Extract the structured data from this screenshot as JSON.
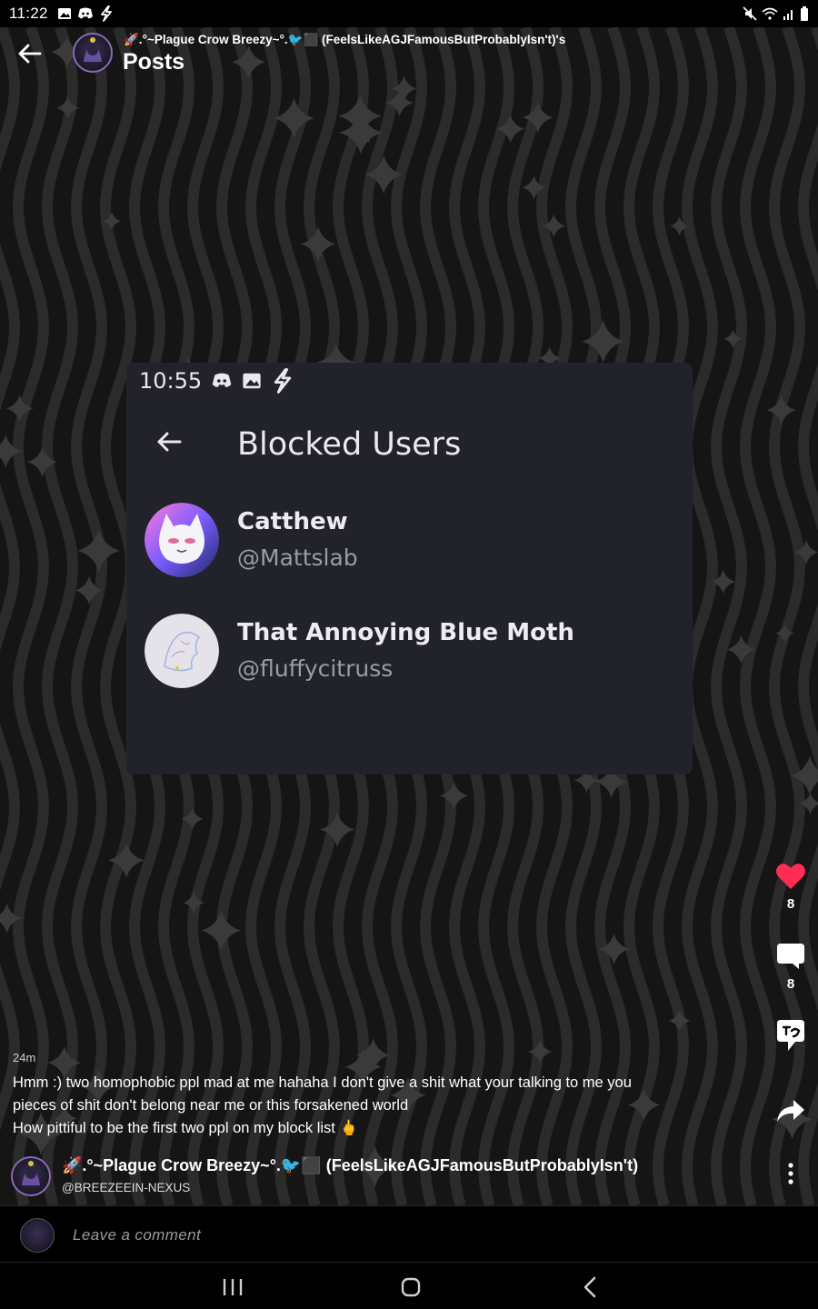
{
  "status_bar": {
    "time": "11:22",
    "left_icons": [
      "gallery-icon",
      "discord-icon",
      "bolt-icon"
    ],
    "right_icons": [
      "mute-icon",
      "wifi-icon",
      "signal-icon",
      "battery-icon"
    ]
  },
  "header": {
    "subtitle": "🚀.°~Plague Crow Breezy~°.🐦⬛ (FeelsLikeAGJFamousButProbablyIsn't)'s",
    "title": "Posts"
  },
  "post_image": {
    "status_time": "10:55",
    "status_icons": [
      "discord-icon",
      "gallery-icon",
      "bolt-icon"
    ],
    "title": "Blocked Users",
    "users": [
      {
        "name": "Catthew",
        "handle": "@Mattslab"
      },
      {
        "name": "That Annoying Blue Moth",
        "handle": "@fluffycitruss"
      }
    ]
  },
  "actions": {
    "like_count": "8",
    "comment_count": "8",
    "colors": {
      "like": "#ff2d55"
    }
  },
  "caption": {
    "timestamp": "24m",
    "text": "Hmm :) two homophobic ppl mad at me hahaha I don't give a shit what your talking to me you\npieces of shit don't belong near me or this forsakened world\nHow pittiful to be the first two ppl on my block list 🖕"
  },
  "author": {
    "name": "🚀.°~Plague Crow Breezy~°.🐦⬛ (FeelsLikeAGJFamousButProbablyIsn't)",
    "handle": "@BREEZEEIN-NEXUS"
  },
  "comment_bar": {
    "placeholder": "Leave a comment"
  }
}
